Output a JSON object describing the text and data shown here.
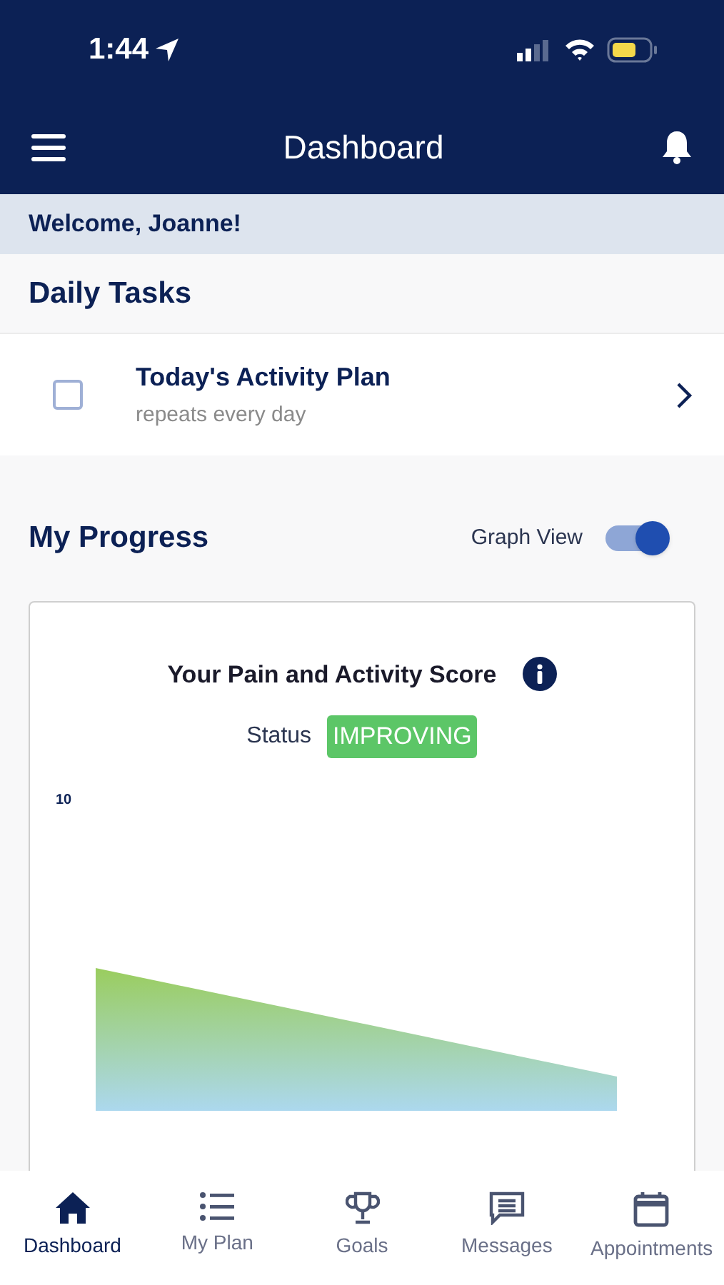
{
  "status_bar": {
    "time": "1:44"
  },
  "header": {
    "title": "Dashboard"
  },
  "welcome": "Welcome, Joanne!",
  "daily_tasks": {
    "title": "Daily Tasks",
    "items": [
      {
        "title": "Today's Activity Plan",
        "subtitle": "repeats every day",
        "checked": false
      }
    ]
  },
  "progress": {
    "title": "My Progress",
    "toggle_label": "Graph View",
    "toggle_on": true,
    "card": {
      "title": "Your Pain and Activity Score",
      "status_label": "Status",
      "status": "IMPROVING",
      "y_axis_label": "10"
    }
  },
  "tab_bar": [
    {
      "label": "Dashboard",
      "kind": "home",
      "selected": true
    },
    {
      "label": "My Plan",
      "kind": "list",
      "selected": false
    },
    {
      "label": "Goals",
      "kind": "trophy",
      "selected": false
    },
    {
      "label": "Messages",
      "kind": "message",
      "selected": false
    },
    {
      "label": "Appointments",
      "kind": "calendar",
      "selected": false
    }
  ]
}
